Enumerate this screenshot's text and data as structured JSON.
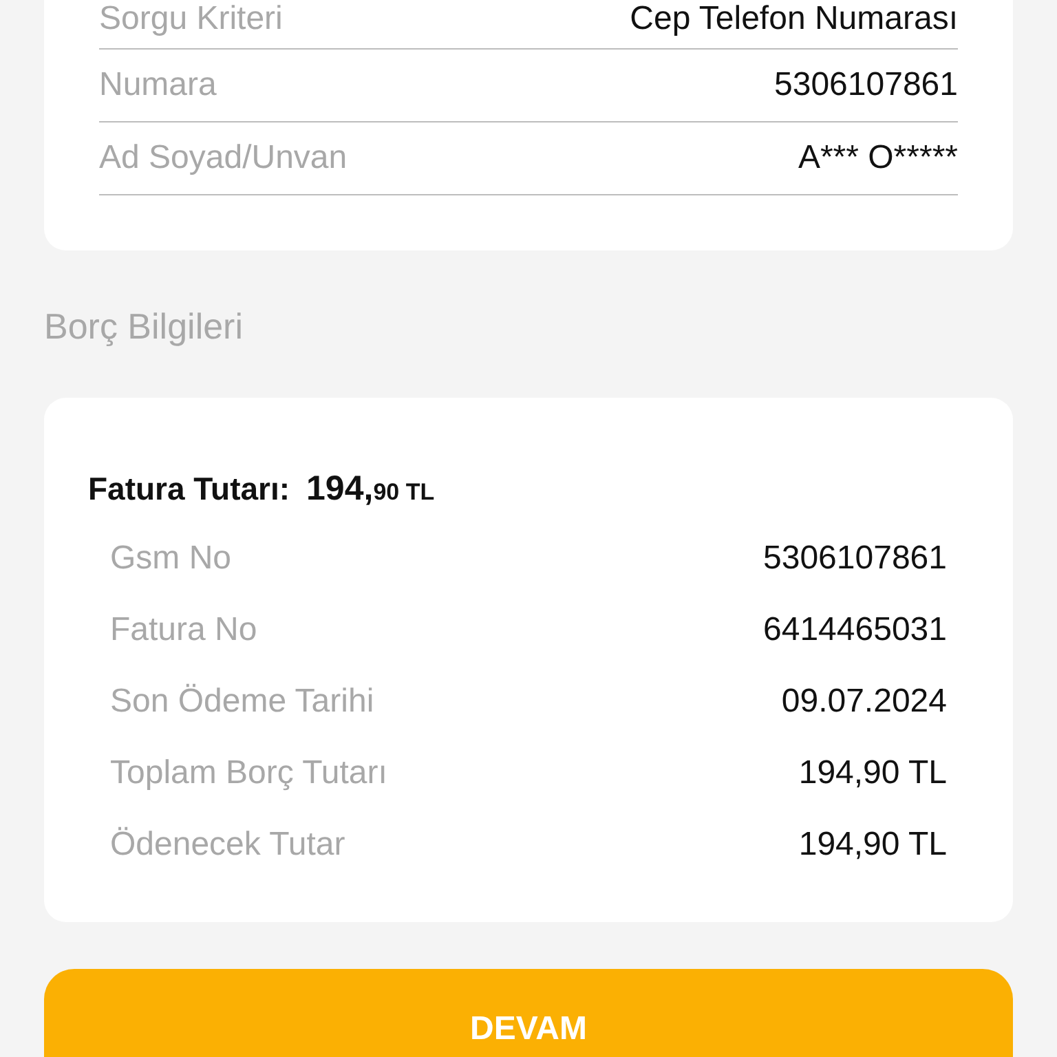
{
  "query_card": {
    "rows": [
      {
        "label": "Sorgu Kriteri",
        "value": "Cep Telefon Numarası"
      },
      {
        "label": "Numara",
        "value": "5306107861"
      },
      {
        "label": "Ad Soyad/Unvan",
        "value": "A*** O*****"
      }
    ]
  },
  "section_title": "Borç Bilgileri",
  "debt_card": {
    "amount_label": "Fatura Tutarı:",
    "amount_whole": "194,",
    "amount_fraction": "90 TL",
    "rows": [
      {
        "label": "Gsm No",
        "value": "5306107861"
      },
      {
        "label": "Fatura No",
        "value": "6414465031"
      },
      {
        "label": "Son Ödeme Tarihi",
        "value": "09.07.2024"
      },
      {
        "label": "Toplam Borç Tutarı",
        "value": "194,90 TL"
      },
      {
        "label": "Ödenecek Tutar",
        "value": "194,90 TL"
      }
    ]
  },
  "continue_button": "DEVAM"
}
